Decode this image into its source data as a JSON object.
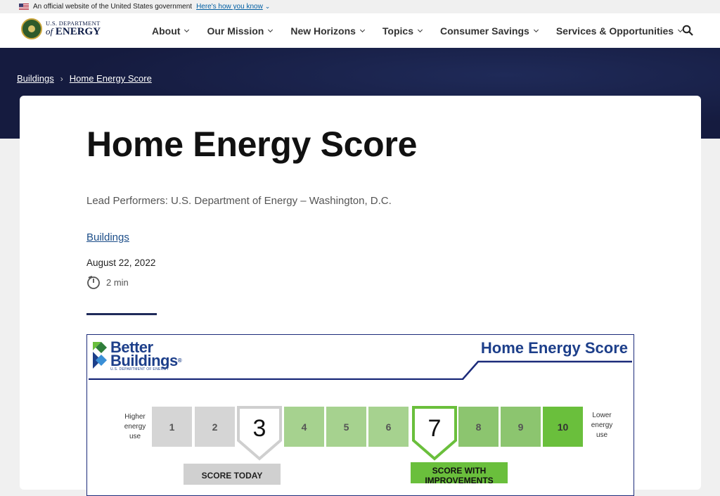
{
  "gov_banner": {
    "text": "An official website of the United States government",
    "link": "Here's how you know"
  },
  "logo": {
    "top": "U.S. DEPARTMENT",
    "of": "of",
    "energy": "ENERGY"
  },
  "nav": {
    "items": [
      {
        "label": "About"
      },
      {
        "label": "Our Mission"
      },
      {
        "label": "New Horizons"
      },
      {
        "label": "Topics"
      },
      {
        "label": "Consumer Savings"
      },
      {
        "label": "Services & Opportunities"
      }
    ]
  },
  "breadcrumb": {
    "items": [
      "Buildings",
      "Home Energy Score"
    ]
  },
  "article": {
    "title": "Home Energy Score",
    "lead": "Lead Performers: U.S. Department of Energy – Washington, D.C.",
    "topic": "Buildings",
    "date": "August 22, 2022",
    "read_time": "2 min"
  },
  "figure": {
    "brand_line1": "Better",
    "brand_line2": "Buildings",
    "brand_reg": "®",
    "brand_sub": "U.S. DEPARTMENT OF ENERGY",
    "title": "Home Energy Score",
    "higher_label": "Higher energy use",
    "lower_label": "Lower energy use",
    "scores": [
      "1",
      "2",
      "3",
      "4",
      "5",
      "6",
      "7",
      "8",
      "9",
      "10"
    ],
    "score_today": "3",
    "score_improved": "7",
    "tag_today": "SCORE TODAY",
    "tag_improved_line1": "SCORE WITH",
    "tag_improved_line2": "IMPROVEMENTS",
    "colors": {
      "gray": "#d5d5d5",
      "green_light": "#a6d28f",
      "green_mid": "#8cc56f",
      "green_dark": "#6abf3c",
      "navy": "#1c2b7a"
    }
  },
  "icons": {
    "flag": "us-flag-icon",
    "search": "search-icon",
    "timer": "timer-icon"
  }
}
